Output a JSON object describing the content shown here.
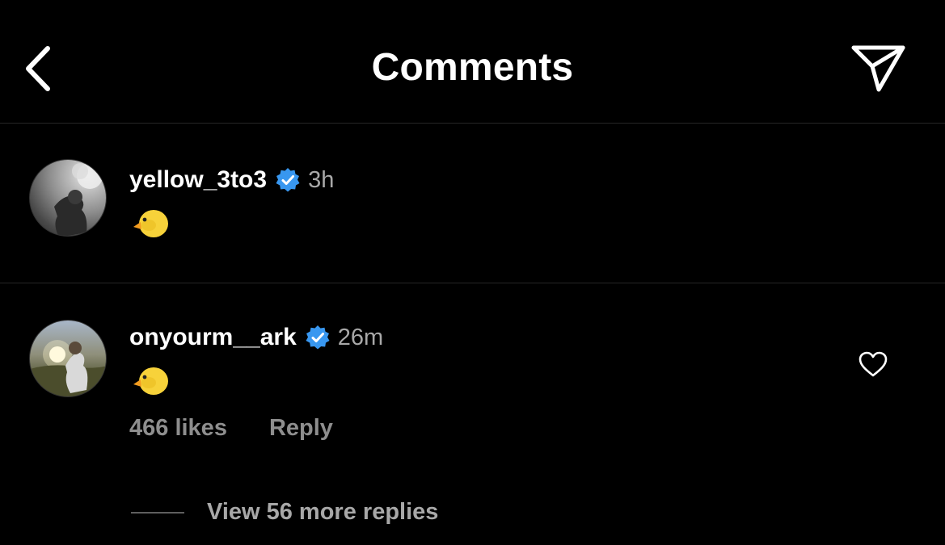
{
  "header": {
    "title": "Comments",
    "back_icon": "chevron-left-icon",
    "share_icon": "paper-plane-icon"
  },
  "comments": [
    {
      "username": "yellow_3to3",
      "verified": true,
      "time": "3h",
      "text": "🐤",
      "avatar": "avatar"
    },
    {
      "username": "onyourm__ark",
      "verified": true,
      "time": "26m",
      "text": "🐤",
      "avatar": "avatar",
      "likes": "466 likes",
      "reply": "Reply",
      "like_icon": "heart-outline-icon",
      "view_replies": "View 56 more replies"
    }
  ],
  "colors": {
    "background": "#000000",
    "verified": "#3897f0",
    "muted_text": "#a8a8a8",
    "divider": "#262626"
  }
}
